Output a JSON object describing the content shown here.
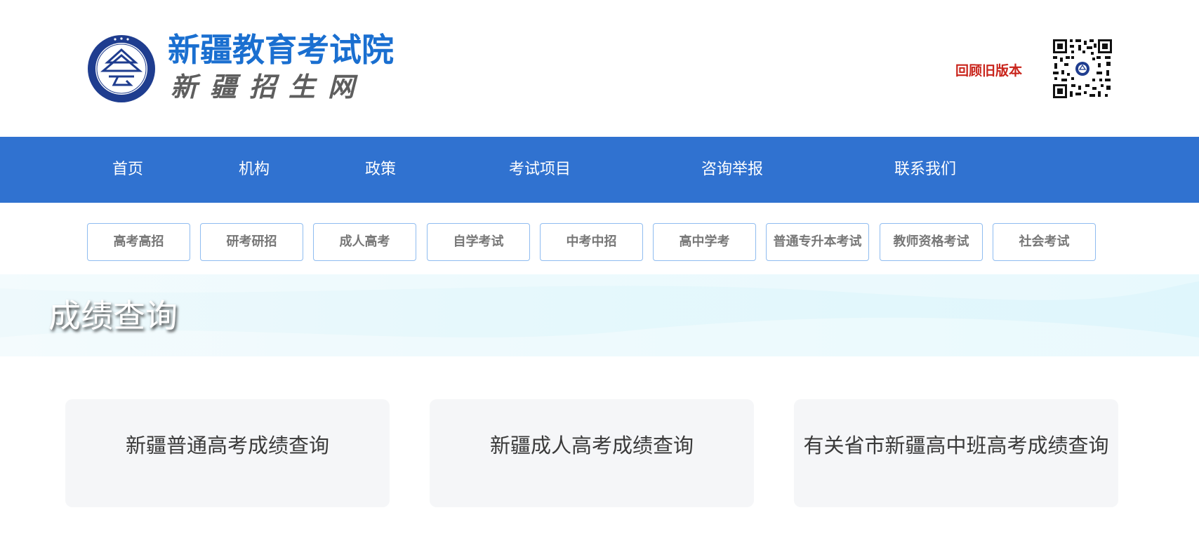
{
  "header": {
    "logo_title": "新疆教育考试院",
    "logo_subtitle": "新疆招生网",
    "old_version_link": "回顾旧版本"
  },
  "main_nav": {
    "items": [
      {
        "label": "首页"
      },
      {
        "label": "机构"
      },
      {
        "label": "政策"
      },
      {
        "label": "考试项目"
      },
      {
        "label": "咨询举报"
      },
      {
        "label": "联系我们"
      }
    ]
  },
  "sub_nav": {
    "items": [
      {
        "label": "高考高招"
      },
      {
        "label": "研考研招"
      },
      {
        "label": "成人高考"
      },
      {
        "label": "自学考试"
      },
      {
        "label": "中考中招"
      },
      {
        "label": "高中学考"
      },
      {
        "label": "普通专升本考试"
      },
      {
        "label": "教师资格考试"
      },
      {
        "label": "社会考试"
      }
    ]
  },
  "banner": {
    "title": "成绩查询"
  },
  "cards": [
    {
      "label": "新疆普通高考成绩查询"
    },
    {
      "label": "新疆成人高考成绩查询"
    },
    {
      "label": "有关省市新疆高中班高考成绩查询"
    }
  ],
  "colors": {
    "brand_blue": "#3072d0",
    "logo_blue": "#1a6fd0",
    "link_red": "#c9241b",
    "sub_nav_border": "#8fbcf0",
    "card_bg": "#f5f6f8"
  }
}
